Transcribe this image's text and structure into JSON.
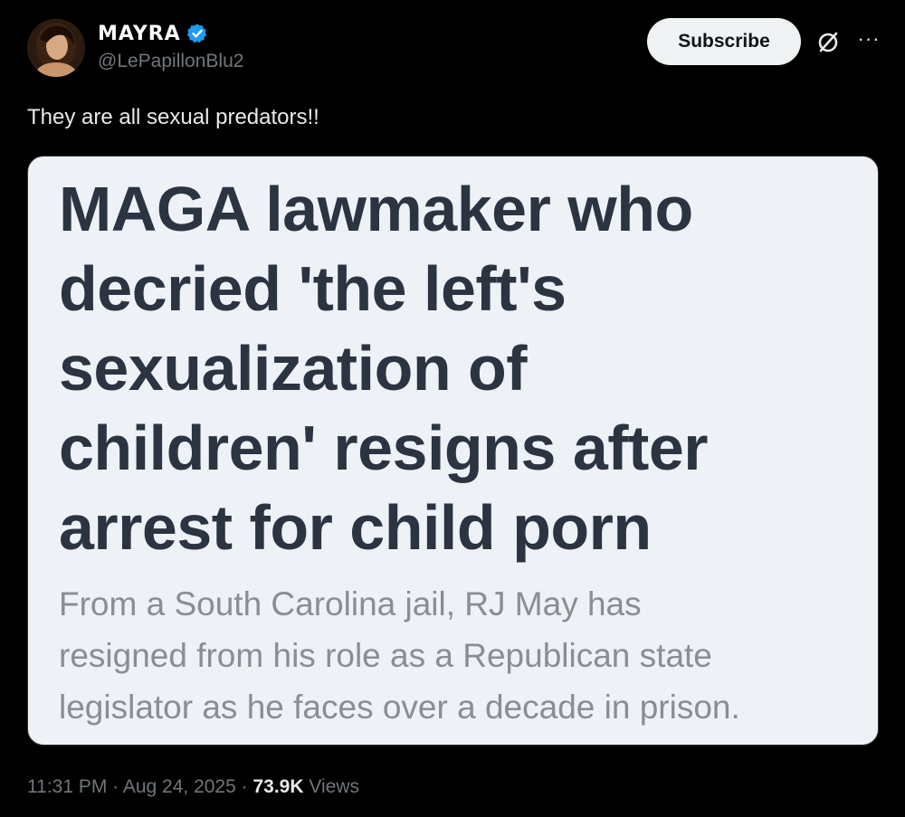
{
  "author": {
    "display_name": "MAYRA",
    "handle": "@LePapillonBlu2",
    "verified": true,
    "verified_color": "#1d9bf0",
    "avatar_icon": "profile-photo"
  },
  "actions": {
    "subscribe_label": "Subscribe",
    "grok_icon": "grok-slash-circle-icon",
    "more_icon": "more-horizontal-icon",
    "more_glyph": "···"
  },
  "tweet": {
    "text": "They are all sexual predators!!"
  },
  "media": {
    "headline_lines": [
      "MAGA lawmaker who",
      "decried 'the left's",
      "sexualization of",
      "children' resigns after",
      "arrest for child porn"
    ],
    "subhead_lines": [
      "From a South Carolina jail, RJ May has",
      "resigned from his role as a Republican state",
      "legislator as he faces over a decade in prison."
    ]
  },
  "meta": {
    "time": "11:31 PM",
    "separator": " · ",
    "date": "Aug 24, 2025",
    "views_count": "73.9K",
    "views_label": " Views"
  }
}
